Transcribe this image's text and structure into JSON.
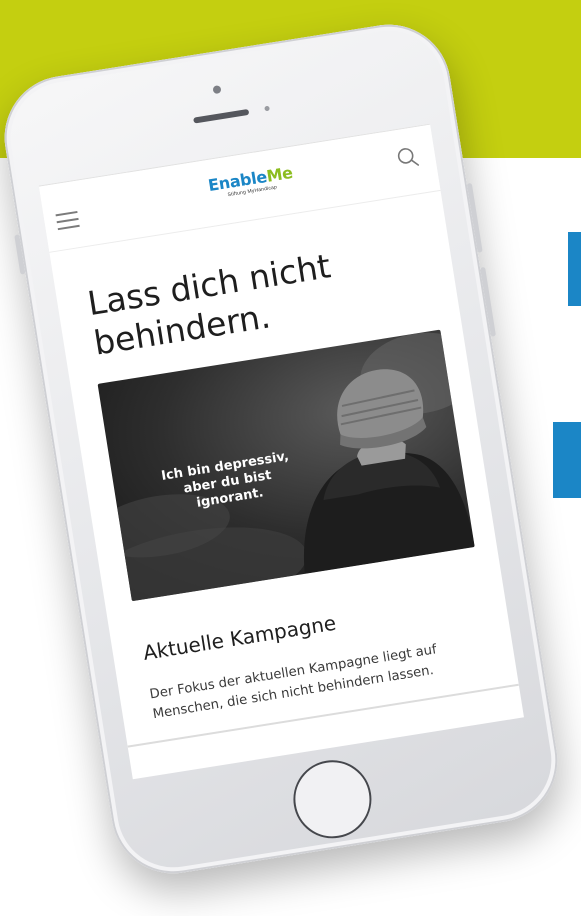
{
  "brand": {
    "name_part1": "Enable",
    "name_part2": "Me",
    "tagline": "Stiftung MyHandicap",
    "colors": {
      "blue": "#1b86c6",
      "green": "#8cbd1f",
      "lime_band": "#c4cf10"
    }
  },
  "header": {
    "menu_icon": "hamburger-icon",
    "search_icon": "search-icon"
  },
  "hero": {
    "headline": "Lass dich nicht behindern.",
    "image_quote": [
      "Ich bin depressiv,",
      "aber du bist",
      "ignorant."
    ]
  },
  "campaign": {
    "title": "Aktuelle Kampagne",
    "text": "Der Fokus der aktuellen Kampagne liegt auf Menschen, die sich nicht behindern lassen."
  }
}
